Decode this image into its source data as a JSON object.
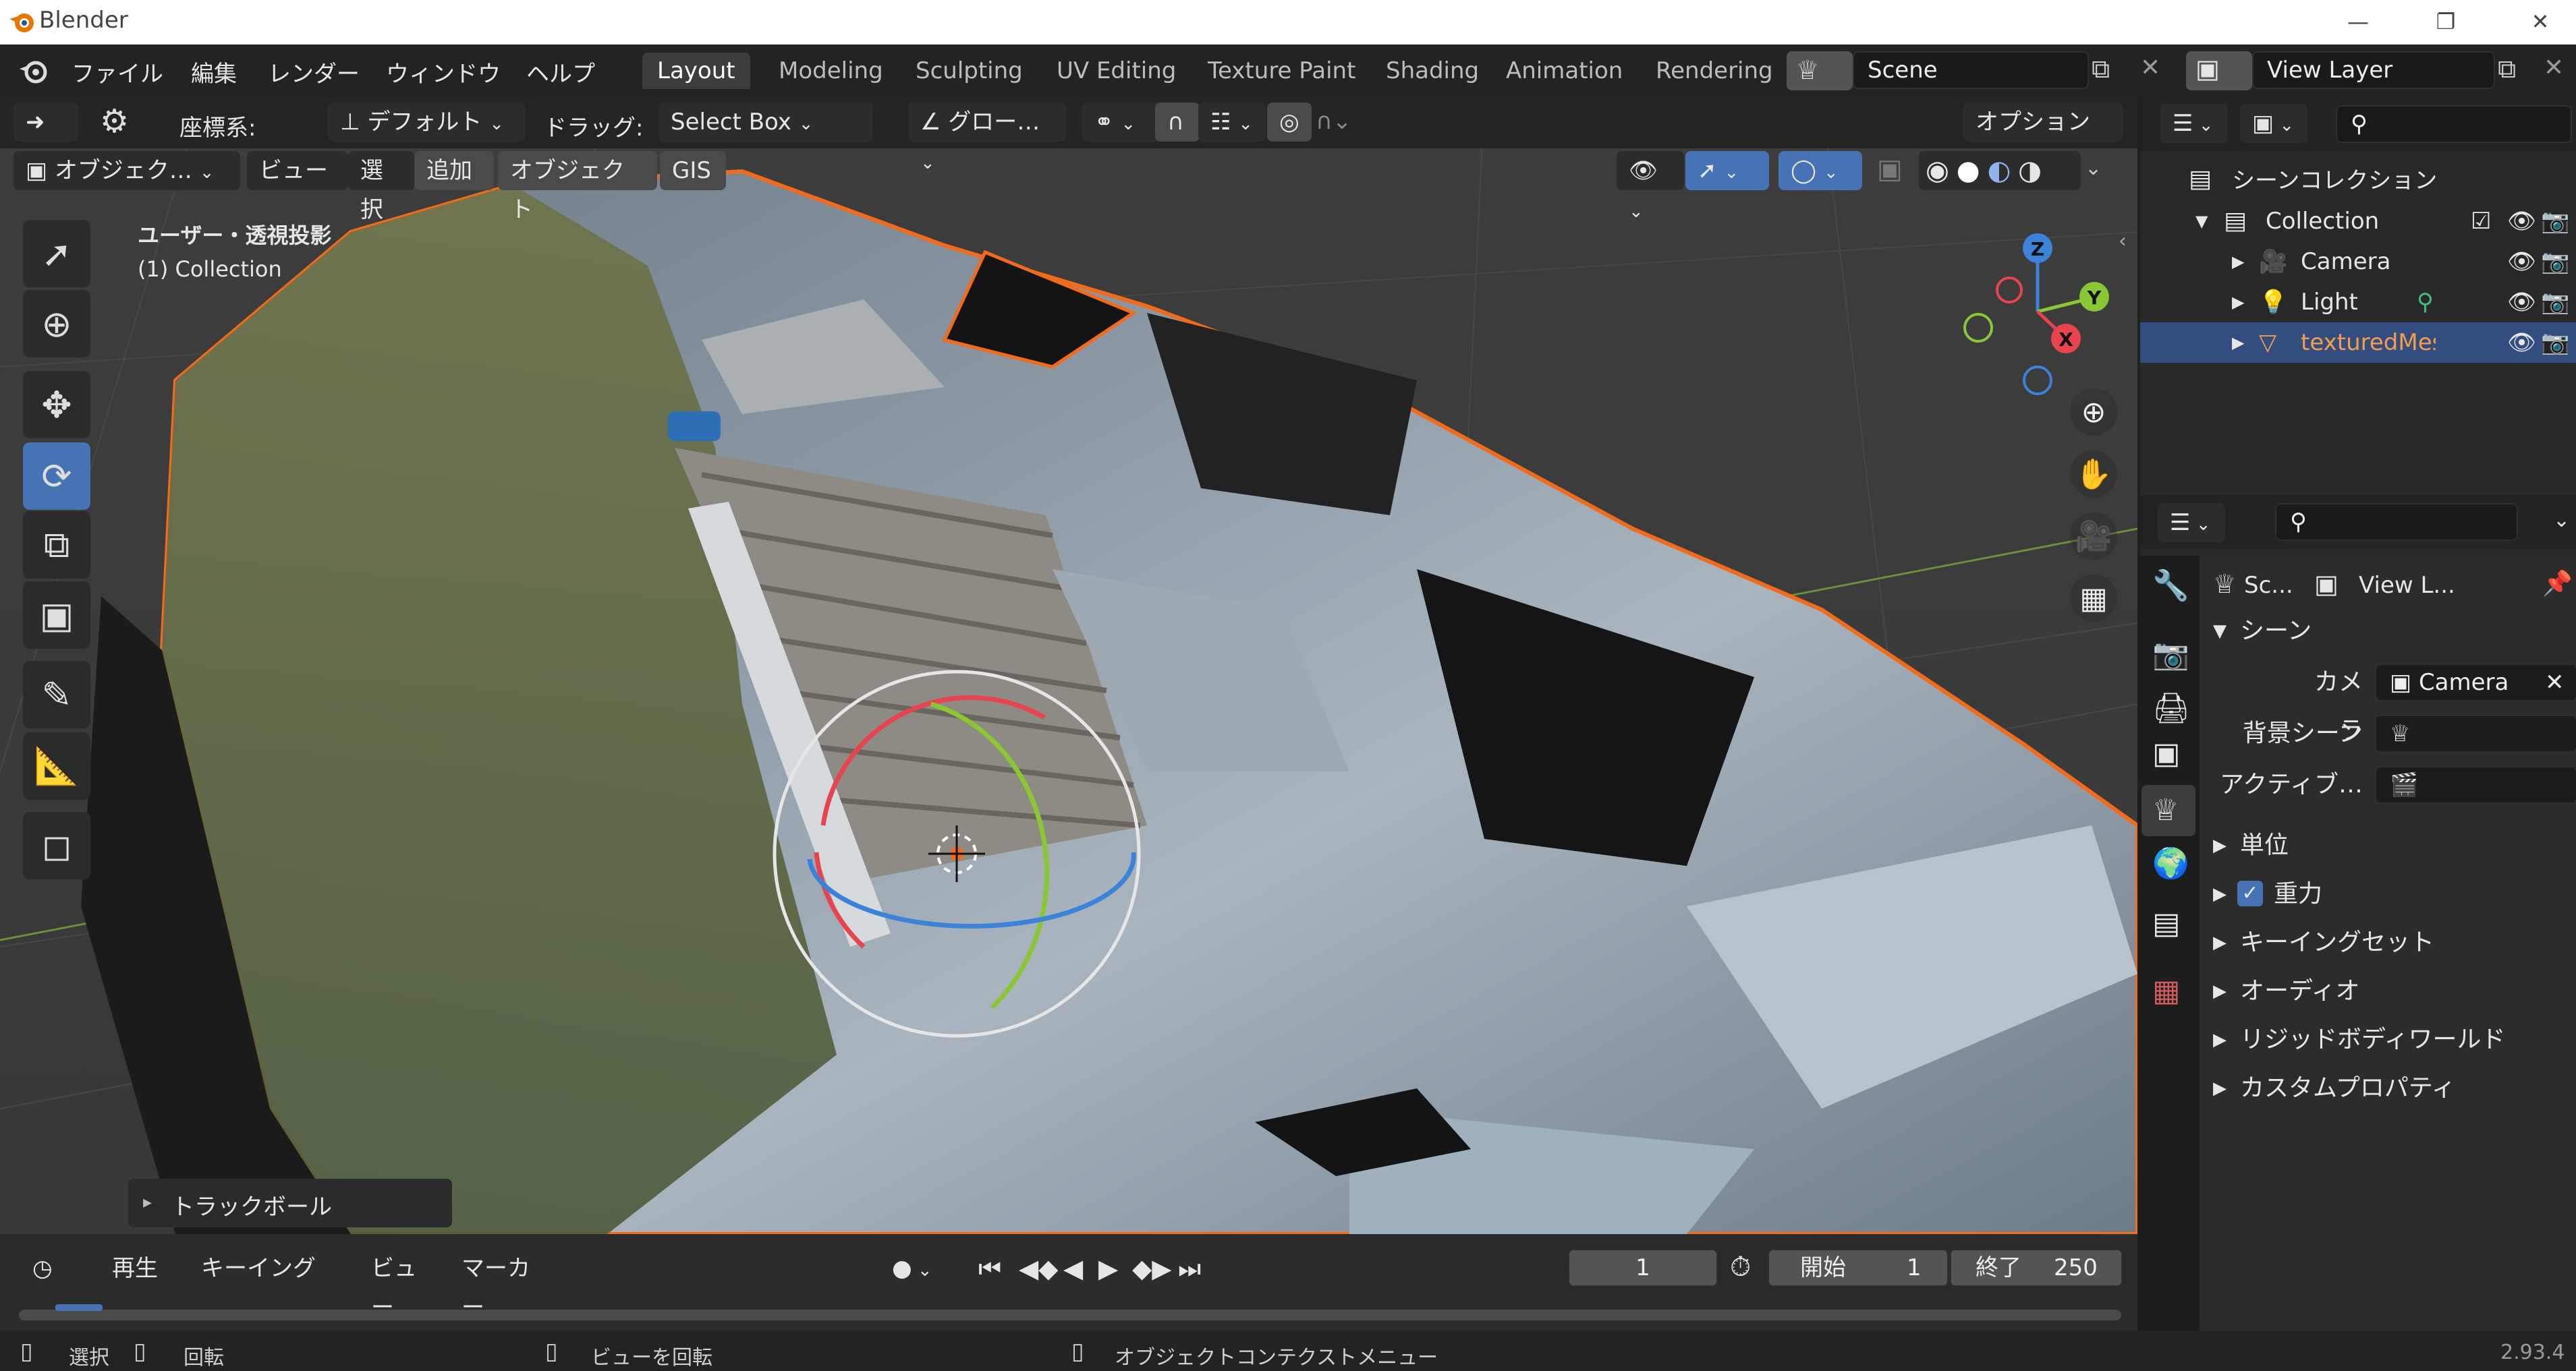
{
  "window": {
    "title": "Blender",
    "minimize": "—",
    "restore": "❐",
    "close": "✕"
  },
  "menubar": {
    "file": "ファイル",
    "edit": "編集",
    "render": "レンダー",
    "window": "ウィンドウ",
    "help": "ヘルプ",
    "workspaces": [
      "Layout",
      "Modeling",
      "Sculpting",
      "UV Editing",
      "Texture Paint",
      "Shading",
      "Animation",
      "Rendering"
    ],
    "scene": "Scene",
    "view_layer": "View Layer"
  },
  "tool_header": {
    "coords_label": "座標系:",
    "coords_value": "デフォルト",
    "drag_label": "ドラッグ:",
    "drag_value": "Select Box",
    "transform": "グロー…",
    "options": "オプション"
  },
  "viewport_header": {
    "mode": "オブジェク…",
    "view": "ビュー",
    "select": "選択",
    "add": "追加",
    "object": "オブジェクト",
    "gis": "GIS"
  },
  "viewport": {
    "view_name": "ユーザー・透視投影",
    "collection": "(1) Collection",
    "gizmo": {
      "x": "X",
      "y": "Y",
      "z": "Z"
    },
    "last_op": "トラックボール"
  },
  "outliner": {
    "root": "シーンコレクション",
    "items": [
      {
        "name": "Collection",
        "selected": false
      },
      {
        "name": "Camera",
        "selected": false
      },
      {
        "name": "Light",
        "selected": false
      },
      {
        "name": "texturedMesl",
        "selected": true
      }
    ]
  },
  "properties": {
    "crumb_scene": "Sc...",
    "crumb_layer": "View L...",
    "section": "シーン",
    "camera_label": "カメラ",
    "camera_value": "Camera",
    "bg_scene_label": "背景シーン",
    "active_label": "アクティブ…",
    "panels": [
      "単位",
      "重力",
      "キーイングセット",
      "オーディオ",
      "リジッドボディワールド",
      "カスタムプロパティ"
    ]
  },
  "timeline": {
    "play": "再生",
    "keying": "キーイング",
    "view": "ビュー",
    "marker": "マーカー",
    "current_frame": "1",
    "start_label": "開始",
    "start": "1",
    "end_label": "終了",
    "end": "250"
  },
  "statusbar": {
    "select": "選択",
    "rotate": "回転",
    "view_rotate": "ビューを回転",
    "context_menu": "オブジェクトコンテクストメニュー",
    "version": "2.93.4"
  },
  "colors": {
    "accent": "#4772b3",
    "selection_orange": "#f26b1d",
    "x_axis": "#e8434f",
    "y_axis": "#8ac733",
    "z_axis": "#3b83d8"
  }
}
